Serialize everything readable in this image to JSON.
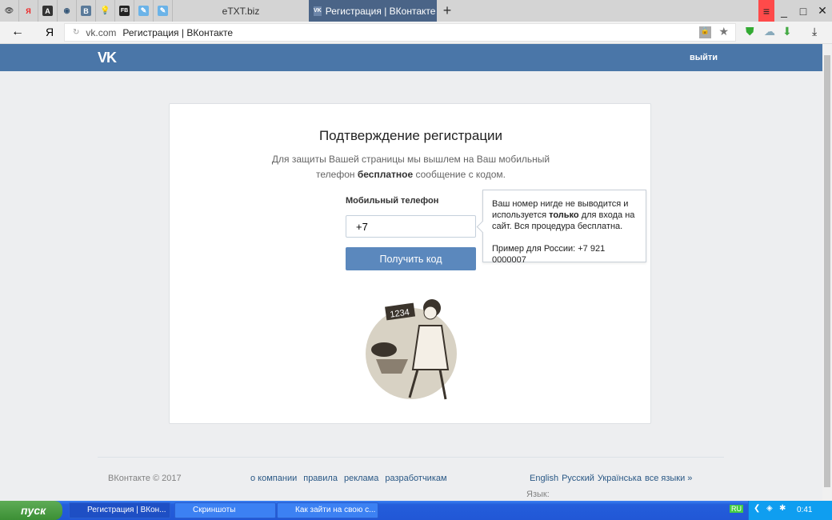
{
  "browser": {
    "pinned_tabs": [
      {
        "icon": "eye-icon",
        "label": "👁"
      },
      {
        "icon": "yandex-icon",
        "label": "Я"
      },
      {
        "icon": "a-icon",
        "label": "A"
      },
      {
        "icon": "globe-icon",
        "label": "◉"
      },
      {
        "icon": "vk-b-icon",
        "label": "B"
      },
      {
        "icon": "bulb-icon",
        "label": "💡"
      },
      {
        "icon": "fb-icon",
        "label": "FB"
      },
      {
        "icon": "note-icon",
        "label": "✎"
      },
      {
        "icon": "note-icon",
        "label": "✎"
      }
    ],
    "tab_etxt": "eTXT.biz",
    "active_tab": "Регистрация | ВКонтакте",
    "address_domain": "vk.com",
    "address_title": "Регистрация | ВКонтакте",
    "yandex_label": "Я"
  },
  "header": {
    "logo": "VK",
    "logout": "выйти"
  },
  "card": {
    "title": "Подтверждение регистрации",
    "desc_1": "Для защиты Вашей страницы мы вышлем на Ваш мобильный телефон ",
    "desc_bold": "бесплатное",
    "desc_2": " сообщение с кодом.",
    "phone_label": "Мобильный телефон",
    "phone_value": "+7",
    "button": "Получить код",
    "tip_1": "Ваш номер нигде не выводится и используется ",
    "tip_bold": "только",
    "tip_2": " для входа на сайт. Вся процедура бесплатна.",
    "tip_example": "Пример для России: +7 921 0000007",
    "sign_text": "1234"
  },
  "footer": {
    "copyright": "ВКонтакте © 2017",
    "links": [
      "о компании",
      "правила",
      "реклама",
      "разработчикам"
    ],
    "lang_label": "Язык:",
    "langs": [
      "English",
      "Русский",
      "Українська",
      "все языки »"
    ]
  },
  "taskbar": {
    "start": "пуск",
    "tasks": [
      "Регистрация | ВКон...",
      "Скриншоты",
      "Как зайти на свою с..."
    ],
    "lang": "RU",
    "time": "0:41"
  }
}
